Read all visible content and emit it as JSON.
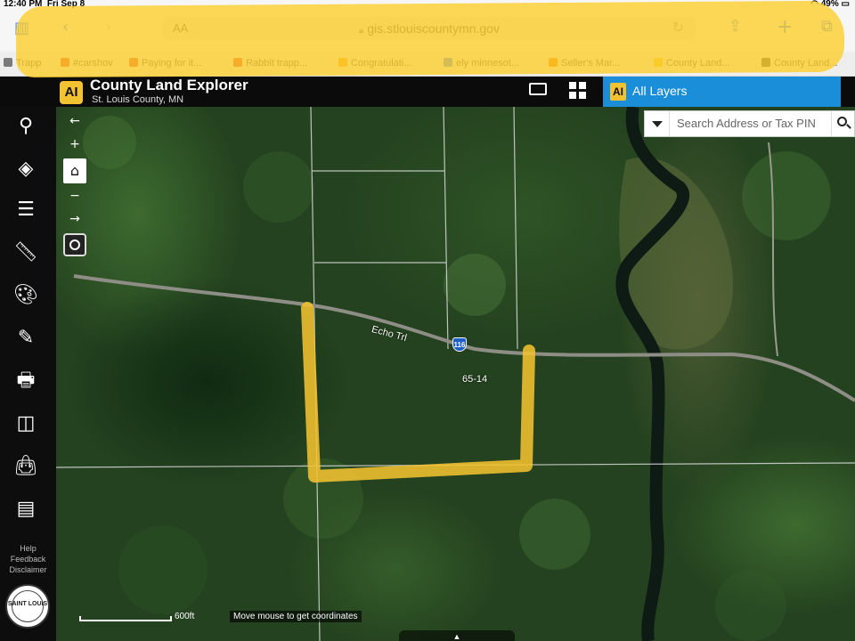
{
  "status_bar": {
    "time": "12:40 PM",
    "date": "Fri Sep 8",
    "battery": "49%"
  },
  "browser": {
    "text_size_label": "AA",
    "url": "gis.stlouiscountymn.gov",
    "toolbar_icons": [
      "sidebar-icon",
      "back-arrow-icon",
      "forward-arrow-icon",
      "reload-icon",
      "share-icon",
      "new-tab-icon",
      "tabs-icon"
    ],
    "favorites": [
      {
        "label": "Trapp",
        "color": "#7a7a7a"
      },
      {
        "label": "#carshov",
        "color": "#e53935"
      },
      {
        "label": "Paying for it...",
        "color": "#e53935"
      },
      {
        "label": "Rabbit trapp...",
        "color": "#e53935"
      },
      {
        "label": "Congratulati...",
        "color": "#f39c12"
      },
      {
        "label": "ely minnesot...",
        "color": "#4285f4"
      },
      {
        "label": "Seller's Mar...",
        "color": "#ef6c00"
      },
      {
        "label": "County Land...",
        "color": "#f2c230"
      },
      {
        "label": "County Land...",
        "color": "#444444"
      }
    ]
  },
  "app": {
    "logo_text": "AI",
    "title": "County Land Explorer",
    "subtitle": "St. Louis County, MN",
    "layers_logo": "AI",
    "layers_label": "All Layers",
    "accent_color": "#1a8ed8",
    "brand_color": "#f2c230"
  },
  "sidebar": {
    "tools": [
      "search-icon",
      "layers-icon",
      "list-icon",
      "ruler-icon",
      "palette-icon",
      "draw-icon",
      "print-icon",
      "split-screen-icon",
      "shopping-bag-icon",
      "legend-icon"
    ],
    "links": {
      "help": "Help",
      "feedback": "Feedback",
      "disclaimer": "Disclaimer"
    },
    "seal_text": "SAINT LOUIS"
  },
  "map": {
    "search_placeholder": "Search Address or Tax PIN",
    "road_label": "Echo Trl",
    "route_number": "116",
    "parcel_label": "65-14",
    "scale_label": "600ft",
    "coords_text": "Move mouse to get coordinates",
    "nav": [
      "back-arrow-icon",
      "zoom-in-icon",
      "home-icon",
      "zoom-out-icon",
      "forward-arrow-icon",
      "locate-icon"
    ],
    "highlight_color": "#f2c230"
  }
}
